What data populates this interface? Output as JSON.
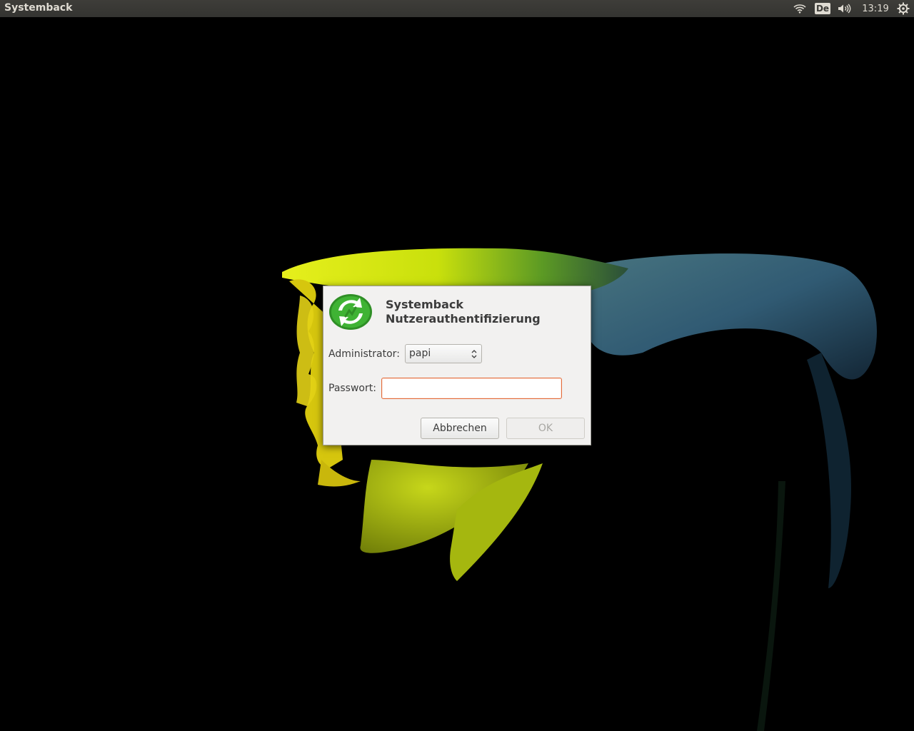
{
  "top_panel": {
    "app_title": "Systemback",
    "keyboard_layout": "De",
    "clock": "13:19",
    "icons": [
      "wifi-icon",
      "volume-icon",
      "session-gear-icon"
    ]
  },
  "dialog": {
    "title_line1": "Systemback",
    "title_line2": "Nutzerauthentifizierung",
    "admin_label": "Administrator:",
    "admin_selected": "papi",
    "password_label": "Passwort:",
    "password_value": "",
    "cancel_label": "Abbrechen",
    "ok_label": "OK",
    "ok_enabled": false,
    "logo_icon": "systemback-logo-icon",
    "colors": {
      "input_focus_border": "#e36c3a",
      "logo_green": "#2fa12a"
    }
  }
}
